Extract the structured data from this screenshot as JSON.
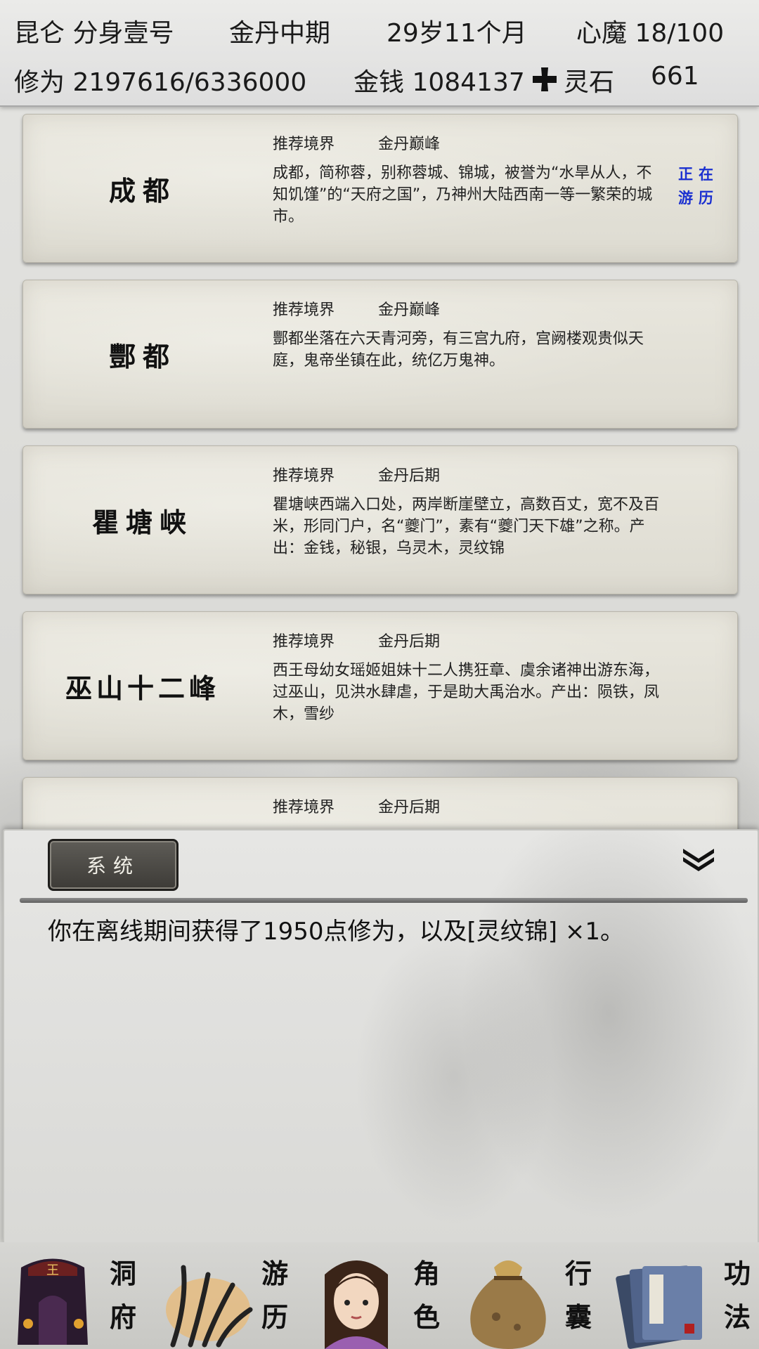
{
  "status_bar": {
    "name": "昆仑 分身壹号",
    "realm": "金丹中期",
    "age": "29岁11个月",
    "heart_demon": "心魔  18/100",
    "cultivation": "修为 2197616/6336000",
    "money": "金钱 1084137",
    "spirit_stone_label": "灵石",
    "spirit_stone_value": "661",
    "spirit_stone_icon": "cross-icon"
  },
  "locations": [
    {
      "name": "成都",
      "rec_label": "推荐境界",
      "rec_value": "金丹巅峰",
      "desc": "成都，简称蓉，别称蓉城、锦城，被誉为“水旱从人，不知饥馑”的“天府之国”，乃神州大陆西南一等一繁荣的城市。",
      "status": "正在游历"
    },
    {
      "name": "酆都",
      "rec_label": "推荐境界",
      "rec_value": "金丹巅峰",
      "desc": "酆都坐落在六天青河旁，有三宫九府，宫阙楼观贵似天庭，鬼帝坐镇在此，统亿万鬼神。",
      "status": ""
    },
    {
      "name": "瞿塘峡",
      "rec_label": "推荐境界",
      "rec_value": "金丹后期",
      "desc": "瞿塘峡西端入口处，两岸断崖壁立，高数百丈，宽不及百米，形同门户，名“夔门”，素有“夔门天下雄”之称。产出：金钱，秘银，乌灵木，灵纹锦",
      "status": ""
    },
    {
      "name": "巫山十二峰",
      "rec_label": "推荐境界",
      "rec_value": "金丹后期",
      "desc": "西王母幼女瑶姬姐妹十二人携狂章、虞余诸神出游东海，过巫山，见洪水肆虐，于是助大禹治水。产出：陨铁，凤木，雪纱",
      "status": ""
    },
    {
      "name": "",
      "rec_label": "推荐境界",
      "rec_value": "金丹后期",
      "desc": "",
      "status": ""
    }
  ],
  "message_panel": {
    "tab_label": "系统",
    "message": "你在离线期间获得了1950点修为，以及[灵纹锦] ×1。",
    "collapse_icon": "double-chevron-down-icon"
  },
  "nav": [
    {
      "label": "洞府",
      "icon": "cave-mansion-icon"
    },
    {
      "label": "游历",
      "icon": "travel-icon"
    },
    {
      "label": "角色",
      "icon": "character-portrait-icon"
    },
    {
      "label": "行囊",
      "icon": "bag-icon"
    },
    {
      "label": "功法",
      "icon": "scroll-book-icon"
    }
  ],
  "colors": {
    "status_active": "#1a2fd0",
    "tab_bg": "#4a4844",
    "card_bg": "#e4e2d8"
  }
}
